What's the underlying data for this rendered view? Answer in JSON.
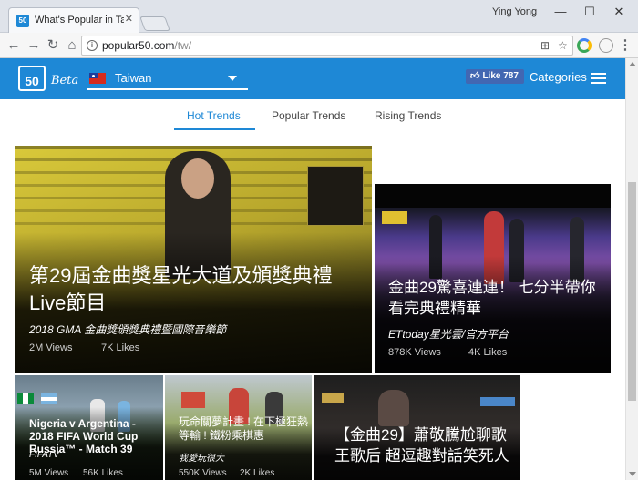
{
  "browser": {
    "tab_title": "What's Popular in Taiwan",
    "tab_favicon": "50",
    "user_name": "Ying Yong",
    "url_host": "popular50.com",
    "url_path": "/tw/",
    "window_min": "—",
    "window_max": "☐",
    "window_close": "✕"
  },
  "header": {
    "logo_text": "50",
    "logo_beta": "Beta",
    "country": "Taiwan",
    "like_label": "Like",
    "like_count": "787",
    "categories_label": "Categories"
  },
  "tabs": [
    {
      "label": "Hot Trends"
    },
    {
      "label": "Popular Trends"
    },
    {
      "label": "Rising Trends"
    }
  ],
  "cards": [
    {
      "title": "第29屆金曲獎星光大道及頒獎典禮Live節目",
      "source": "2018 GMA 金曲獎頒獎典禮暨國際音樂節",
      "views": "2M Views",
      "likes": "7K Likes"
    },
    {
      "title": "金曲29驚喜連連！ 七分半帶你看完典禮精華",
      "source": "ETtoday星光雲/官方平台",
      "views": "878K Views",
      "likes": "4K Likes"
    },
    {
      "title": "Nigeria v Argentina - 2018 FIFA World Cup Russia™ - Match 39",
      "source": "FIFATV",
      "views": "5M Views",
      "likes": "56K Likes"
    },
    {
      "title": "玩命關夢計畫 ! 在下極狂熱等輸 ! 鐵粉乘棋惠",
      "source": "我愛玩很大",
      "views": "550K Views",
      "likes": "2K Likes"
    },
    {
      "title": "【金曲29】蕭敬騰尬聊歌王歌后 超逗趣對話笑死人",
      "source": "",
      "views": "",
      "likes": ""
    }
  ],
  "colors": {
    "brand": "#1e88d6",
    "facebook": "#4267b2"
  }
}
